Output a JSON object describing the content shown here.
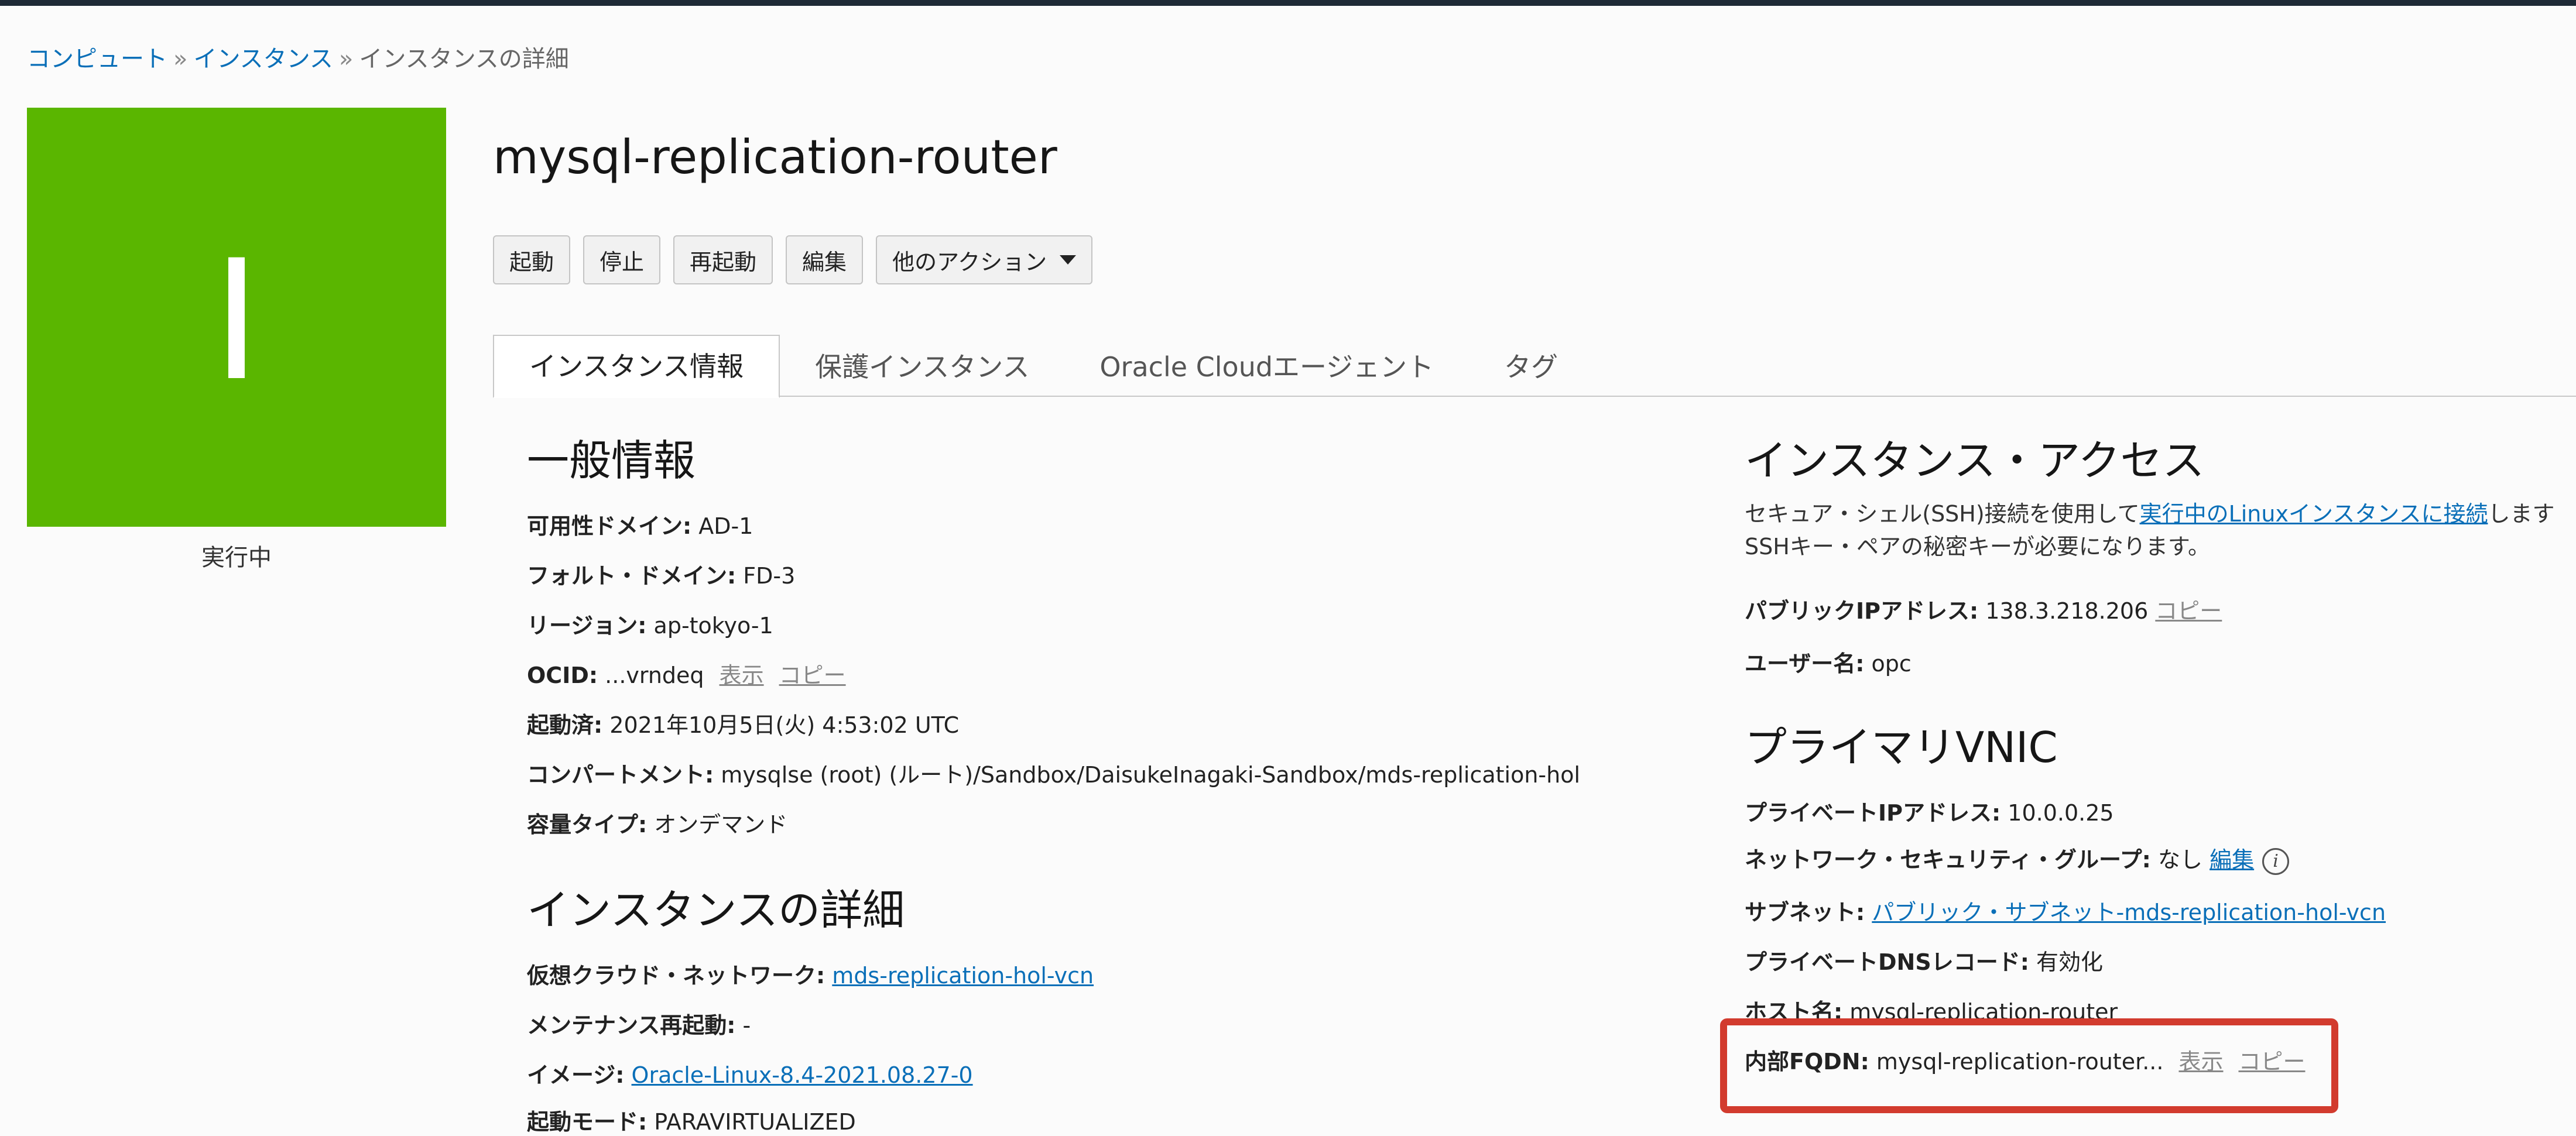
{
  "breadcrumb": {
    "compute": "コンピュート",
    "sep": "»",
    "instances": "インスタンス",
    "current": "インスタンスの詳細"
  },
  "instance": {
    "tile_letter": "I",
    "state": "実行中",
    "title": "mysql-replication-router"
  },
  "actions": {
    "start": "起動",
    "stop": "停止",
    "restart": "再起動",
    "edit": "編集",
    "more": "他のアクション"
  },
  "tabs": [
    "インスタンス情報",
    "保護インスタンス",
    "Oracle Cloudエージェント",
    "タグ"
  ],
  "general": {
    "heading": "一般情報",
    "availability_domain": {
      "label": "可用性ドメイン:",
      "value": "AD-1"
    },
    "fault_domain": {
      "label": "フォルト・ドメイン:",
      "value": "FD-3"
    },
    "region": {
      "label": "リージョン:",
      "value": "ap-tokyo-1"
    },
    "ocid": {
      "label": "OCID:",
      "value": "...vrndeq",
      "show": "表示",
      "copy": "コピー"
    },
    "launched": {
      "label": "起動済:",
      "value": "2021年10月5日(火) 4:53:02 UTC"
    },
    "compartment": {
      "label": "コンパートメント:",
      "value": "mysqlse (root) (ルート)/Sandbox/DaisukeInagaki-Sandbox/mds-replication-hol"
    },
    "capacity_type": {
      "label": "容量タイプ:",
      "value": "オンデマンド"
    }
  },
  "details": {
    "heading": "インスタンスの詳細",
    "vcn": {
      "label": "仮想クラウド・ネットワーク:",
      "value": "mds-replication-hol-vcn"
    },
    "maintenance_reboot": {
      "label": "メンテナンス再起動:",
      "value": "-"
    },
    "image": {
      "label": "イメージ:",
      "value": "Oracle-Linux-8.4-2021.08.27-0"
    },
    "launch_mode": {
      "label": "起動モード:",
      "value": "PARAVIRTUALIZED"
    }
  },
  "access": {
    "heading": "インスタンス・アクセス",
    "desc_pre": "セキュア・シェル(SSH)接続を使用して",
    "desc_link": "実行中のLinuxインスタンスに接続",
    "desc_post": "します",
    "desc_line2": "SSHキー・ペアの秘密キーが必要になります。",
    "public_ip": {
      "label": "パブリックIPアドレス:",
      "value": "138.3.218.206",
      "copy": "コピー"
    },
    "username": {
      "label": "ユーザー名:",
      "value": "opc"
    }
  },
  "vnic": {
    "heading": "プライマリVNIC",
    "private_ip": {
      "label": "プライベートIPアドレス:",
      "value": "10.0.0.25"
    },
    "nsg": {
      "label": "ネットワーク・セキュリティ・グループ:",
      "value": "なし",
      "edit": "編集",
      "info": "i"
    },
    "subnet": {
      "label": "サブネット:",
      "value": "パブリック・サブネット-mds-replication-hol-vcn"
    },
    "private_dns": {
      "label": "プライベートDNSレコード:",
      "value": "有効化"
    },
    "hostname": {
      "label": "ホスト名:",
      "value": "mysql-replication-router"
    },
    "fqdn": {
      "label": "内部FQDN:",
      "value": "mysql-replication-router...",
      "show": "表示",
      "copy": "コピー"
    }
  },
  "colors": {
    "tile": "#5ab600",
    "link": "#0a6fb8",
    "highlight": "#d23b2e"
  }
}
